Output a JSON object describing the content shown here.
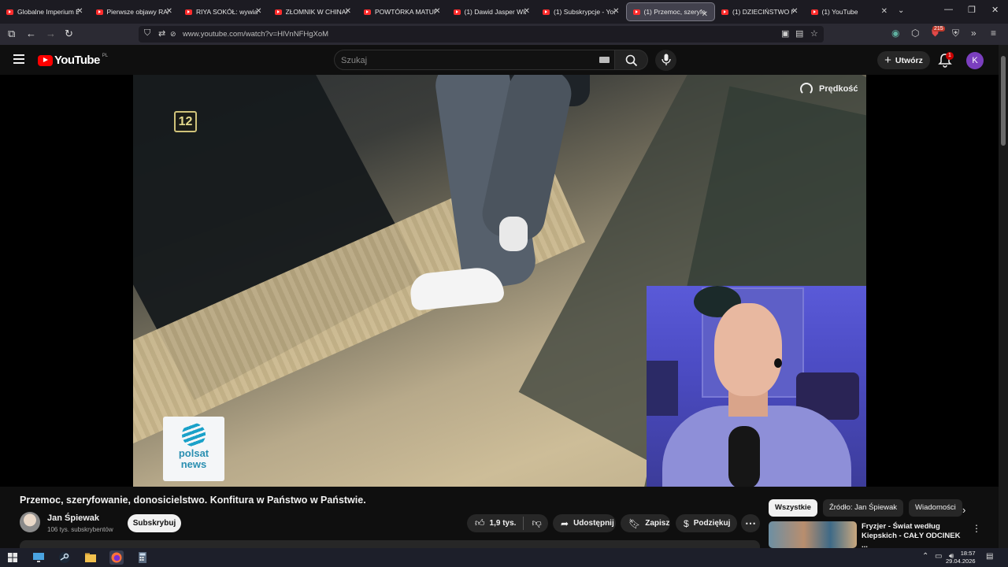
{
  "browser": {
    "tabs": [
      {
        "title": "Globalne Imperium B",
        "active": false
      },
      {
        "title": "Pierwsze objawy RAK",
        "active": false
      },
      {
        "title": "RIYA SOKÓŁ: wywiad",
        "active": false
      },
      {
        "title": "ZŁOMNIK W CHINAC",
        "active": false
      },
      {
        "title": "POWTÓRKA MATUR/",
        "active": false
      },
      {
        "title": "(1) Dawid Jasper WIZ",
        "active": false
      },
      {
        "title": "(1) Subskrypcje - You",
        "active": false
      },
      {
        "title": "(1) Przemoc, szeryfo",
        "active": true
      },
      {
        "title": "(1) DZIECIŃSTWO NA",
        "active": false
      },
      {
        "title": "(1) YouTube",
        "active": false
      }
    ],
    "url": "www.youtube.com/watch?v=HlVnNFHgXoM",
    "extension_badge": "215"
  },
  "youtube": {
    "logo_text": "YouTube",
    "country_code": "PL",
    "search_placeholder": "Szukaj",
    "create_label": "Utwórz",
    "notification_count": "1",
    "avatar_letter": "K"
  },
  "player": {
    "overlay_speed_label": "Prędkość",
    "channel_number": "12",
    "watermark_line1": "polsat",
    "watermark_line2": "news"
  },
  "video": {
    "title": "Przemoc, szeryfowanie, donosicielstwo. Konfitura w Państwo w Państwie.",
    "channel_name": "Jan Śpiewak",
    "subscribers": "106 tys. subskrybentów",
    "subscribe_label": "Subskrybuj",
    "likes": "1,9 tys.",
    "share_label": "Udostępnij",
    "save_label": "Zapisz",
    "thanks_label": "Podziękuj"
  },
  "sidebar": {
    "chips": [
      {
        "label": "Wszystkie",
        "selected": true
      },
      {
        "label": "Źródło: Jan Śpiewak",
        "selected": false
      },
      {
        "label": "Wiadomości",
        "selected": false
      }
    ],
    "recommendation": {
      "title": "Fryzjer - Świat według Kiepskich - CAŁY ODCINEK ..."
    }
  },
  "taskbar": {
    "time": "18:57",
    "date": "29.04.2026"
  },
  "colors": {
    "youtube_red": "#ff0000",
    "background": "#0f0f0f",
    "browser_chrome": "#2b2a33",
    "avatar_purple": "#7b3fbf"
  }
}
